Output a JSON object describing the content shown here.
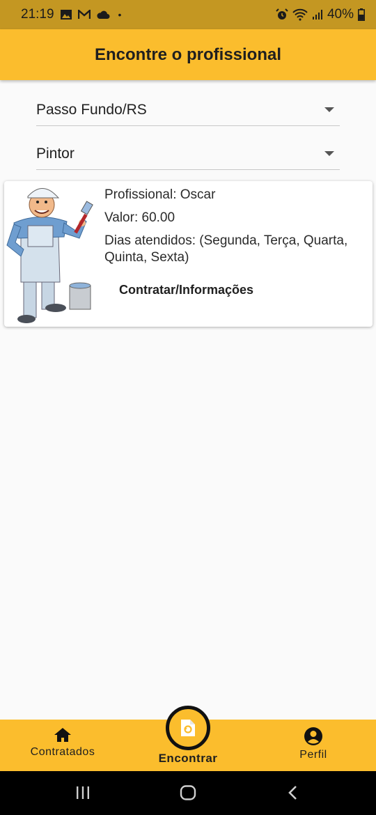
{
  "status_bar": {
    "time": "21:19",
    "battery": "40%",
    "dot": "•",
    "left_icons": [
      "image-icon",
      "gmail-icon",
      "cloud-icon"
    ],
    "right_icons": [
      "alarm-icon",
      "wifi-icon",
      "signal-icon",
      "battery-icon"
    ]
  },
  "app_bar": {
    "title": "Encontre o profissional",
    "color": "#fbbd2d"
  },
  "filters": {
    "city": "Passo Fundo/RS",
    "profession": "Pintor"
  },
  "results": [
    {
      "image": "painter-illustration",
      "professional": "Profissional: Oscar",
      "value": "Valor: 60.00",
      "days": "Dias atendidos: (Segunda, Terça, Quarta, Quinta, Sexta)",
      "action_label": "Contratar/Informações"
    }
  ],
  "bottom_nav": {
    "items": [
      {
        "label": "Contratados",
        "icon": "home-icon"
      },
      {
        "label": "Encontrar",
        "icon": "find-document-icon",
        "active": true
      },
      {
        "label": "Perfil",
        "icon": "account-circle-icon"
      }
    ]
  },
  "system_nav": {
    "icons": [
      "recents-icon",
      "home-button-icon",
      "back-icon"
    ]
  }
}
